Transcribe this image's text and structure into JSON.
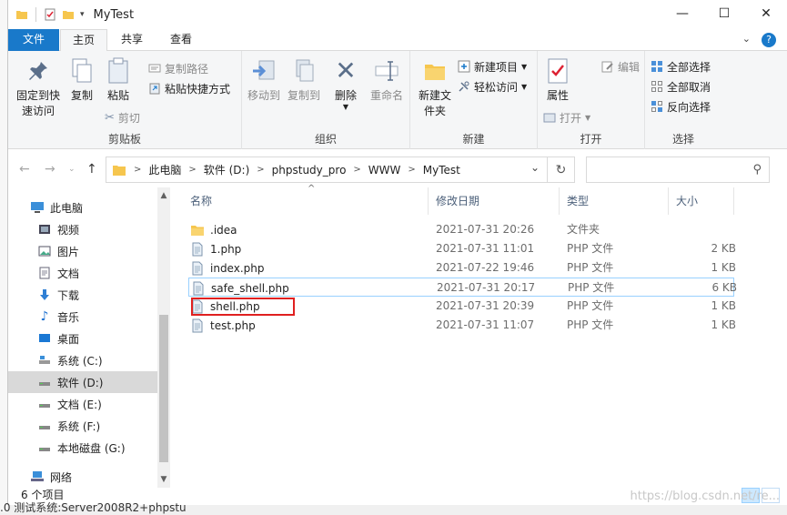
{
  "window": {
    "title": "MyTest"
  },
  "tabs": {
    "file": "文件",
    "home": "主页",
    "share": "共享",
    "view": "查看"
  },
  "ribbon": {
    "clipboard": {
      "label": "剪贴板",
      "pin": "固定到快速访问",
      "copy": "复制",
      "paste": "粘贴",
      "copy_path": "复制路径",
      "paste_shortcut": "粘贴快捷方式",
      "cut": "剪切"
    },
    "organize": {
      "label": "组织",
      "move_to": "移动到",
      "copy_to": "复制到",
      "delete": "删除",
      "rename": "重命名"
    },
    "new": {
      "label": "新建",
      "new_folder": "新建文件夹",
      "new_item": "新建项目",
      "easy_access": "轻松访问"
    },
    "open": {
      "label": "打开",
      "properties": "属性",
      "open": "打开",
      "edit": "编辑"
    },
    "select": {
      "label": "选择",
      "select_all": "全部选择",
      "select_none": "全部取消",
      "invert": "反向选择"
    }
  },
  "address": {
    "crumbs": [
      "此电脑",
      "软件 (D:)",
      "phpstudy_pro",
      "WWW",
      "MyTest"
    ]
  },
  "nav": {
    "items": [
      {
        "label": "此电脑",
        "icon": "computer-icon"
      },
      {
        "label": "视频",
        "icon": "video-icon"
      },
      {
        "label": "图片",
        "icon": "picture-icon"
      },
      {
        "label": "文档",
        "icon": "document-icon"
      },
      {
        "label": "下载",
        "icon": "download-icon"
      },
      {
        "label": "音乐",
        "icon": "music-icon"
      },
      {
        "label": "桌面",
        "icon": "desktop-icon"
      },
      {
        "label": "系统 (C:)",
        "icon": "system-drive-icon"
      },
      {
        "label": "软件 (D:)",
        "icon": "drive-icon"
      },
      {
        "label": "文档 (E:)",
        "icon": "drive-icon"
      },
      {
        "label": "系统 (F:)",
        "icon": "drive-icon"
      },
      {
        "label": "本地磁盘 (G:)",
        "icon": "drive-icon"
      },
      {
        "label": "网络",
        "icon": "network-icon"
      }
    ]
  },
  "columns": {
    "name": "名称",
    "date": "修改日期",
    "type": "类型",
    "size": "大小"
  },
  "files": [
    {
      "name": ".idea",
      "date": "2021-07-31 20:26",
      "type": "文件夹",
      "size": "",
      "icon": "folder-icon"
    },
    {
      "name": "1.php",
      "date": "2021-07-31 11:01",
      "type": "PHP 文件",
      "size": "2 KB",
      "icon": "php-file-icon"
    },
    {
      "name": "index.php",
      "date": "2021-07-22 19:46",
      "type": "PHP 文件",
      "size": "1 KB",
      "icon": "php-file-icon"
    },
    {
      "name": "safe_shell.php",
      "date": "2021-07-31 20:17",
      "type": "PHP 文件",
      "size": "6 KB",
      "icon": "php-file-icon"
    },
    {
      "name": "shell.php",
      "date": "2021-07-31 20:39",
      "type": "PHP 文件",
      "size": "1 KB",
      "icon": "php-file-icon"
    },
    {
      "name": "test.php",
      "date": "2021-07-31 11:07",
      "type": "PHP 文件",
      "size": "1 KB",
      "icon": "php-file-icon"
    }
  ],
  "status": {
    "item_count": "6 个项目"
  },
  "footer": {
    "text": ".0 测试系统:Server2008R2+phpstu",
    "watermark": "https://blog.csdn.net/re..."
  },
  "colors": {
    "accent": "#1979ca",
    "highlight_box": "#e02020",
    "folder": "#f6c64e"
  }
}
